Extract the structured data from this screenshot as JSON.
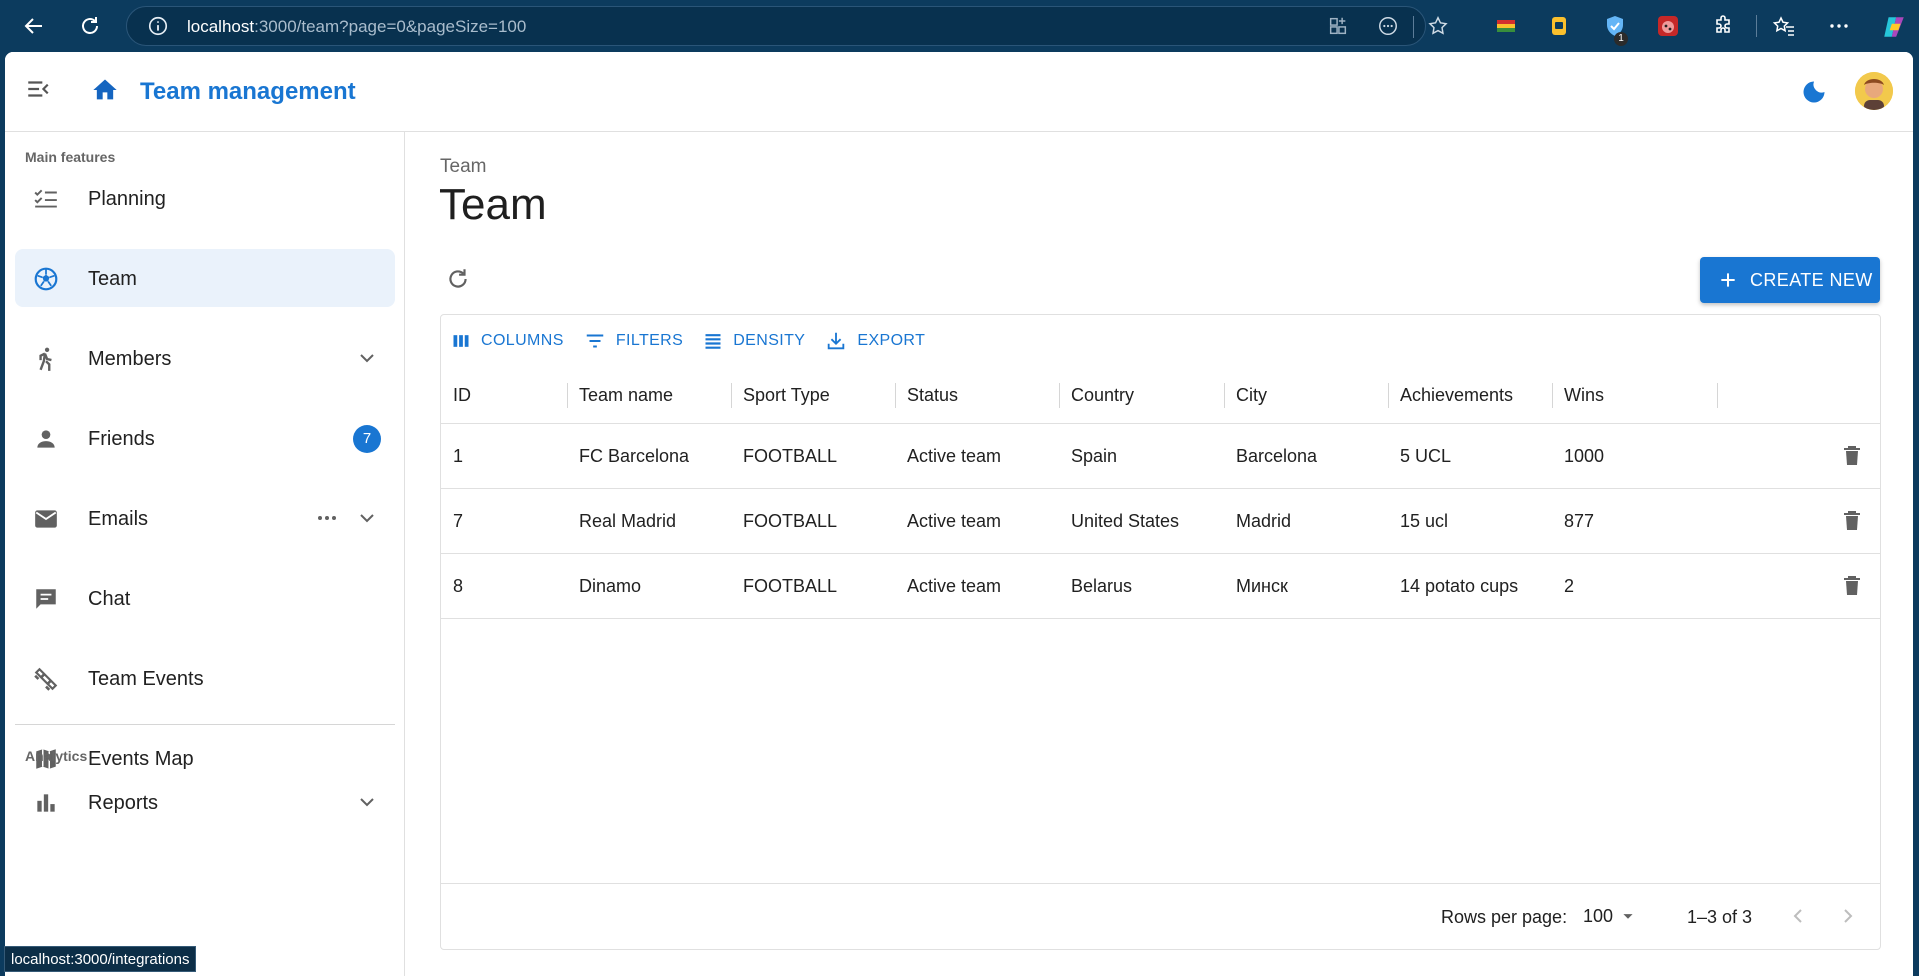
{
  "browser": {
    "url_host": "localhost",
    "url_rest": ":3000/team?page=0&pageSize=100",
    "extension_badge": "1",
    "status_link": "localhost:3000/integrations"
  },
  "app": {
    "title": "Team management"
  },
  "sidebar": {
    "section_main": "Main features",
    "items": [
      {
        "label": "Planning",
        "icon": "checklist-icon"
      },
      {
        "label": "Team",
        "icon": "soccer-ball-icon",
        "active": true
      },
      {
        "label": "Members",
        "icon": "person-walking-icon"
      },
      {
        "label": "Friends",
        "icon": "person-icon",
        "badge": "7"
      },
      {
        "label": "Emails",
        "icon": "mail-icon"
      },
      {
        "label": "Chat",
        "icon": "chat-icon"
      },
      {
        "label": "Team Events",
        "icon": "fitness-icon"
      },
      {
        "label": "Events Map",
        "icon": "map-icon"
      }
    ],
    "section_analytics": "Analytics",
    "analytics_items": [
      {
        "label": "Reports",
        "icon": "bar-chart-icon"
      }
    ]
  },
  "main": {
    "breadcrumb": "Team",
    "title": "Team",
    "create_label": "CREATE NEW",
    "toolbar": {
      "columns": "COLUMNS",
      "filters": "FILTERS",
      "density": "DENSITY",
      "export": "EXPORT"
    },
    "table": {
      "headers": [
        "ID",
        "Team name",
        "Sport Type",
        "Status",
        "Country",
        "City",
        "Achievements",
        "Wins"
      ],
      "rows": [
        [
          "1",
          "FC Barcelona",
          "FOOTBALL",
          "Active team",
          "Spain",
          "Barcelona",
          "5 UCL",
          "1000"
        ],
        [
          "7",
          "Real Madrid",
          "FOOTBALL",
          "Active team",
          "United States",
          "Madrid",
          "15 ucl",
          "877"
        ],
        [
          "8",
          "Dinamo",
          "FOOTBALL",
          "Active team",
          "Belarus",
          "Минск",
          "14 potato cups",
          "2"
        ]
      ]
    },
    "footer": {
      "rows_per_page_label": "Rows per page:",
      "rows_per_page_value": "100",
      "range": "1–3 of 3"
    }
  },
  "colors": {
    "primary": "#1976d2",
    "browser_frame": "#0c3b5e",
    "active_nav_bg": "#eaf2fb"
  }
}
